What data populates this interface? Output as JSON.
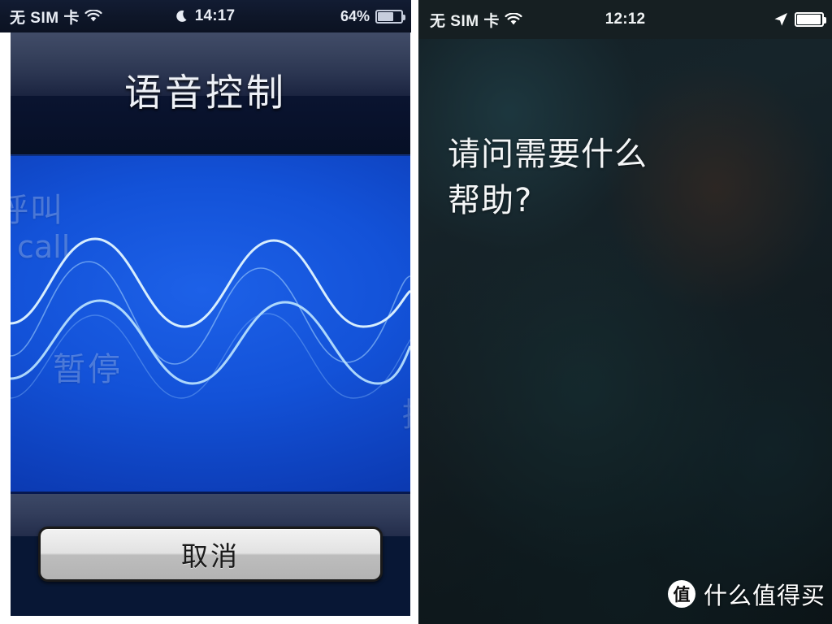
{
  "left_phone": {
    "status_bar": {
      "carrier": "无 SIM 卡",
      "wifi_icon": "wifi-icon",
      "dnd_icon": "crescent-moon-icon",
      "time": "14:17",
      "battery_percent": "64%",
      "battery_icon": "battery-icon",
      "battery_level": 64
    },
    "title": "语音控制",
    "panel": {
      "commands": [
        {
          "text": "呼叫",
          "name": "command-call-zh"
        },
        {
          "text": "call",
          "name": "command-call-en"
        },
        {
          "text": "暂停",
          "name": "command-pause-zh"
        },
        {
          "text": "播",
          "name": "command-clipped-zh"
        }
      ],
      "waveform_name": "audio-waveform"
    },
    "cancel_button": "取消"
  },
  "right_phone": {
    "status_bar": {
      "carrier": "无 SIM 卡",
      "wifi_icon": "wifi-icon",
      "time": "12:12",
      "location_icon": "location-arrow-icon",
      "battery_icon": "battery-icon",
      "battery_level": 95
    },
    "siri_prompt": {
      "line1": "请问需要什么",
      "line2": "帮助?"
    }
  },
  "watermark": {
    "logo_text": "值",
    "label": "什么值得买"
  },
  "colors": {
    "panel_blue": "#1352d8",
    "title_bar_slate": "#36415c",
    "dark_navy": "#081735",
    "siri_dark": "#16242a",
    "status_text": "#e9edf5"
  }
}
